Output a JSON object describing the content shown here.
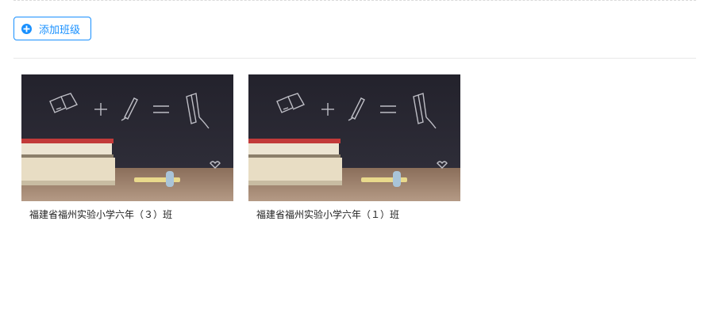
{
  "toolbar": {
    "add_class_label": "添加班级",
    "accent_color": "#1890ff"
  },
  "classes": [
    {
      "name": "福建省福州实验小学六年（３）班",
      "cover_icon": "classroom-chalkboard-image"
    },
    {
      "name": "福建省福州实验小学六年（１）班",
      "cover_icon": "classroom-chalkboard-image"
    }
  ]
}
